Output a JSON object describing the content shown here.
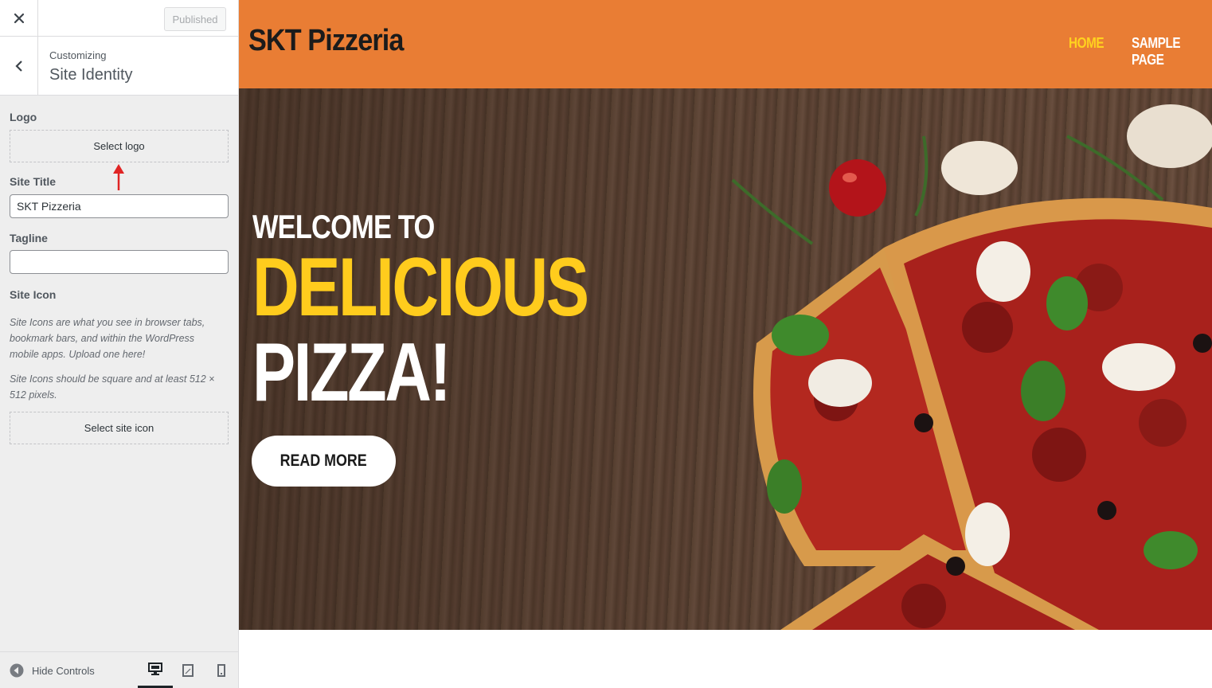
{
  "customizer": {
    "publish_label": "Published",
    "customizing_label": "Customizing",
    "section_title": "Site Identity",
    "logo": {
      "label": "Logo",
      "button": "Select logo"
    },
    "site_title": {
      "label": "Site Title",
      "value": "SKT Pizzeria"
    },
    "tagline": {
      "label": "Tagline",
      "value": ""
    },
    "site_icon": {
      "label": "Site Icon",
      "desc1": "Site Icons are what you see in browser tabs, bookmark bars, and within the WordPress mobile apps. Upload one here!",
      "desc2": "Site Icons should be square and at least 512 × 512 pixels.",
      "button": "Select site icon"
    },
    "footer": {
      "hide_controls": "Hide Controls"
    },
    "icons": [
      "close-icon",
      "chevron-left-icon",
      "arrow-up-icon",
      "circle-arrow-left-icon",
      "desktop-icon",
      "tablet-icon",
      "mobile-icon"
    ]
  },
  "preview": {
    "site_title": "SKT Pizzeria",
    "nav": [
      {
        "label": "HOME",
        "active": true
      },
      {
        "label": "SAMPLE PAGE",
        "active": false
      }
    ],
    "hero": {
      "line1": "WELCOME TO",
      "line2": "DELICIOUS",
      "line3": "PIZZA!",
      "button": "READ MORE"
    }
  },
  "colors": {
    "header_bg": "#e97d34",
    "accent_yellow": "#ffcc1d",
    "nav_active": "#ffd21f",
    "annotation_arrow": "#e02424"
  }
}
